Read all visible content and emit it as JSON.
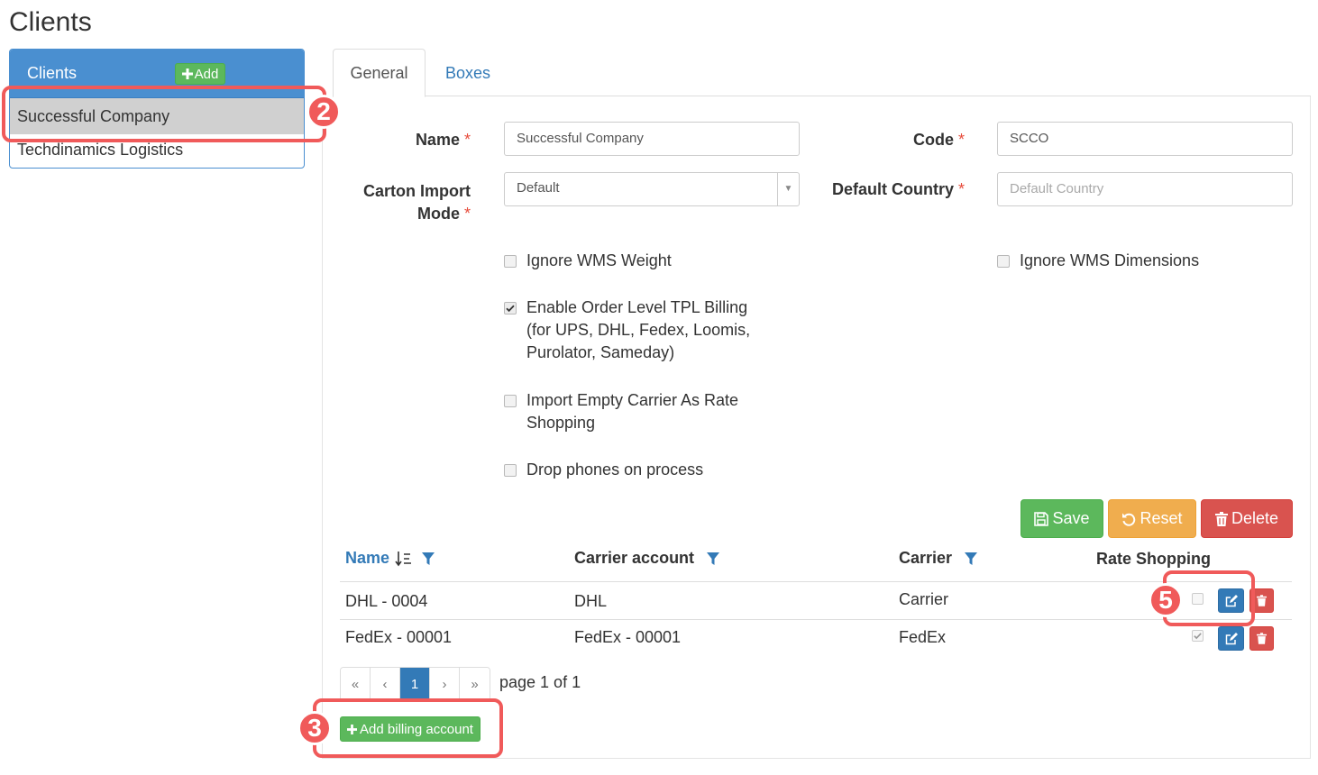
{
  "page": {
    "title": "Clients"
  },
  "clients_panel": {
    "header": "Clients",
    "add_label": "Add",
    "items": [
      "Successful Company",
      "Techdinamics Logistics"
    ],
    "selected_index": 0
  },
  "tabs": [
    {
      "label": "General",
      "active": true
    },
    {
      "label": "Boxes",
      "active": false
    }
  ],
  "form": {
    "name": {
      "label": "Name",
      "required": "*",
      "value": "Successful Company"
    },
    "code": {
      "label": "Code",
      "required": "*",
      "value": "SCCO"
    },
    "carton_import_mode": {
      "label_line1": "Carton Import",
      "label_line2": "Mode",
      "required": "*",
      "value": "Default"
    },
    "default_country": {
      "label": "Default Country",
      "required": "*",
      "placeholder": "Default Country"
    },
    "checkboxes": {
      "ignore_wms_weight": {
        "label": "Ignore WMS Weight",
        "checked": false
      },
      "ignore_wms_dimensions": {
        "label": "Ignore WMS Dimensions",
        "checked": false
      },
      "enable_order_level_tpl": {
        "line1": "Enable Order Level TPL Billing",
        "line2": "(for UPS, DHL, Fedex, Loomis,",
        "line3": "Purolator, Sameday)",
        "checked": true
      },
      "import_empty_carrier": {
        "line1": "Import Empty Carrier As Rate",
        "line2": "Shopping",
        "checked": false
      },
      "drop_phones": {
        "label": "Drop phones on process",
        "checked": false
      }
    }
  },
  "actions": {
    "save": "Save",
    "reset": "Reset",
    "delete": "Delete"
  },
  "billing_grid": {
    "columns": {
      "name": "Name",
      "carrier_account": "Carrier account",
      "carrier": "Carrier",
      "rate_shopping": "Rate Shopping"
    },
    "rows": [
      {
        "name": "DHL - 0004",
        "carrier_account": "DHL",
        "carrier": "Carrier",
        "rate_shopping": false
      },
      {
        "name": "FedEx - 00001",
        "carrier_account": "FedEx - 00001",
        "carrier": "FedEx",
        "rate_shopping": true
      }
    ],
    "pager": {
      "first": "«",
      "prev": "‹",
      "current": "1",
      "next": "›",
      "last": "»",
      "text": "page 1 of 1"
    },
    "add_label": "Add billing account"
  },
  "callouts": {
    "selected_client": "2",
    "add_billing": "3",
    "row_actions": "5"
  },
  "colors": {
    "primary": "#337ab7",
    "panel_head": "#4a8fd0",
    "success": "#5cb85c",
    "warning": "#f0ad4e",
    "danger": "#d9534f",
    "callout": "#f05a5a"
  }
}
